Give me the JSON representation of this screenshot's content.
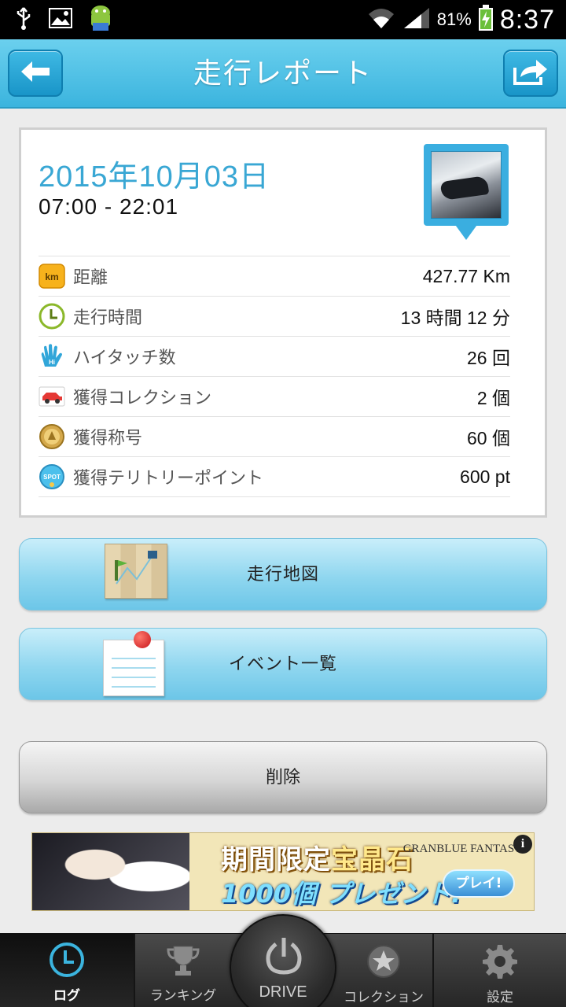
{
  "status_bar": {
    "battery_percent": "81%",
    "time": "8:37",
    "icons": [
      "usb-icon",
      "image-icon",
      "android-icon",
      "wifi-icon",
      "signal-icon",
      "battery-charging-icon"
    ]
  },
  "header": {
    "title": "走行レポート",
    "back_icon": "arrow-left-icon",
    "share_icon": "share-arrow-icon"
  },
  "report": {
    "date": "2015年10月03日",
    "time_range": "07:00 - 22:01",
    "km_badge": "km",
    "hi_badge": "Hi",
    "spot_badge": "SPOT",
    "stats": [
      {
        "label": "距離",
        "value": "427.77 Km",
        "icon": "km-icon"
      },
      {
        "label": "走行時間",
        "value": "13 時間 12 分",
        "icon": "clock-icon"
      },
      {
        "label": "ハイタッチ数",
        "value": "26 回",
        "icon": "high-five-icon"
      },
      {
        "label": "獲得コレクション",
        "value": "2 個",
        "icon": "car-icon"
      },
      {
        "label": "獲得称号",
        "value": "60 個",
        "icon": "medal-icon"
      },
      {
        "label": "獲得テリトリーポイント",
        "value": "600 pt",
        "icon": "spot-icon"
      }
    ]
  },
  "actions": {
    "map_label": "走行地図",
    "events_label": "イベント一覧",
    "delete_label": "削除"
  },
  "ad": {
    "line1_a": "期間限定",
    "line1_b": "宝晶石",
    "line2": "1000個 プレゼント!",
    "logo": "GRANBLUE FANTASY",
    "play": "プレイ!",
    "info": "i"
  },
  "bottom_nav": {
    "items": [
      {
        "label": "ログ",
        "icon": "clock-icon",
        "active": true
      },
      {
        "label": "ランキング",
        "icon": "trophy-icon",
        "active": false
      },
      {
        "label": "DRIVE",
        "icon": "power-icon",
        "active": false
      },
      {
        "label": "コレクション",
        "icon": "star-icon",
        "active": false
      },
      {
        "label": "設定",
        "icon": "gear-icon",
        "active": false
      }
    ]
  },
  "colors": {
    "header": "#3bb4de",
    "date": "#39a7d4",
    "accent_button": "#8fd6ef",
    "delete_button": "#bdbdbd"
  }
}
